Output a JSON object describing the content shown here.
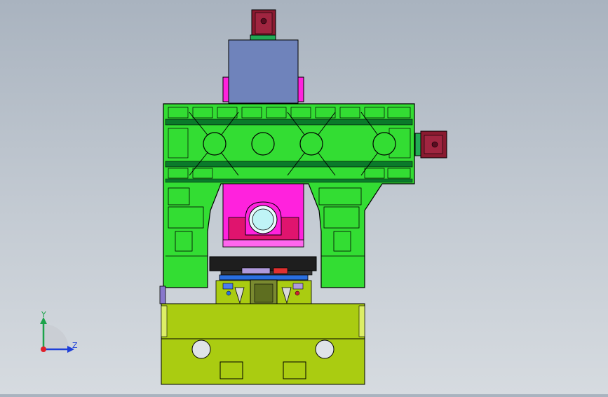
{
  "triad": {
    "y_label": "Y",
    "z_label": "Z"
  },
  "colors": {
    "frame_green": "#33dd33",
    "dark_green": "#0a7a2a",
    "magenta": "#ff22dd",
    "slate_blue": "#6f83bb",
    "maroon": "#8a1a30",
    "olive_base": "#aacc11",
    "black_plate": "#1e1e1e",
    "blue_rail": "#2a6fe0",
    "lavender": "#b09adc",
    "cyan_bore": "#bff4f6"
  }
}
